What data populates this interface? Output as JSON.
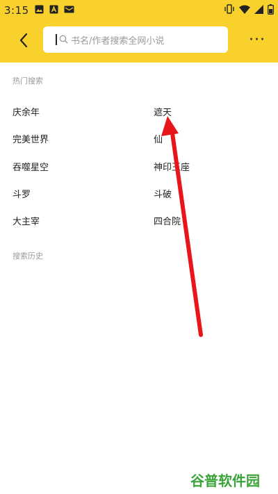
{
  "status_bar": {
    "time": "3:15",
    "icons_left": [
      "gallery-icon",
      "a-app-icon",
      "mail-icon"
    ],
    "icons_right": [
      "vibrate-icon",
      "wifi-icon",
      "cellular-signal-icon",
      "battery-icon"
    ]
  },
  "nav": {
    "back_icon": "chevron-left-icon",
    "search_placeholder": "书名/作者搜索全网小说",
    "more_label": "···"
  },
  "hot_search": {
    "title": "热门搜索",
    "items": [
      "庆余年",
      "遮天",
      "完美世界",
      "仙",
      "吞噬星空",
      "神印王座",
      "斗罗",
      "斗破",
      "大主宰",
      "四合院"
    ]
  },
  "history": {
    "title": "搜索历史"
  },
  "annotation": {
    "arrow_color": "#e8161b"
  },
  "watermark": {
    "text": "谷普软件园"
  },
  "colors": {
    "header_bg": "#f9d12d",
    "watermark_green": "#3aa33a"
  }
}
